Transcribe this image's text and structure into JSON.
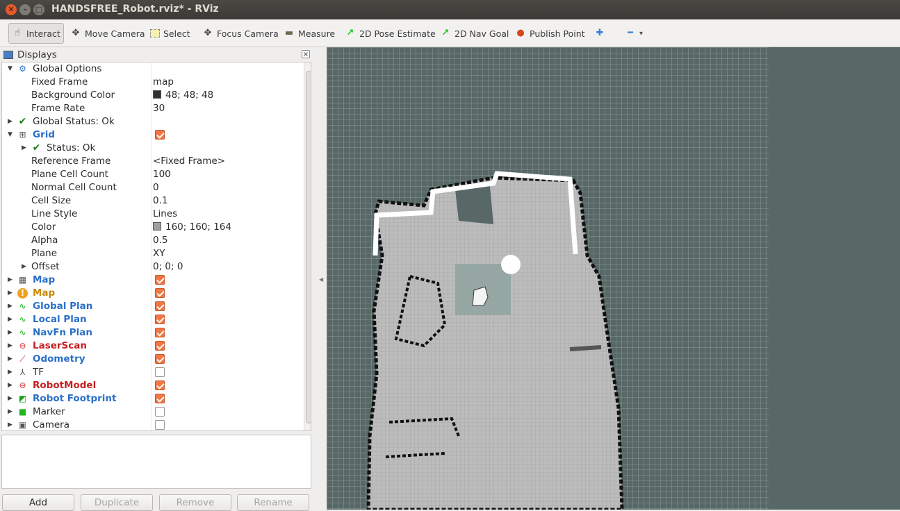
{
  "window": {
    "title": "HANDSFREE_Robot.rviz* - RViz",
    "close_glyph": "✕",
    "min_glyph": "–",
    "max_glyph": "□"
  },
  "toolbar": {
    "items": [
      {
        "label": "Interact",
        "icon": "hand-icon",
        "glyph": "☝"
      },
      {
        "label": "Move Camera",
        "icon": "move-camera-icon",
        "glyph": "✥"
      },
      {
        "label": "Select",
        "icon": "select-icon",
        "glyph": "⬚"
      },
      {
        "label": "Focus Camera",
        "icon": "focus-camera-icon",
        "glyph": "✥"
      },
      {
        "label": "Measure",
        "icon": "ruler-icon",
        "glyph": "▬"
      },
      {
        "label": "2D Pose Estimate",
        "icon": "green-arrow-icon",
        "glyph": "↗"
      },
      {
        "label": "2D Nav Goal",
        "icon": "green-arrow-icon",
        "glyph": "↗"
      },
      {
        "label": "Publish Point",
        "icon": "map-pin-icon",
        "glyph": "●"
      }
    ],
    "add_glyph": "✚",
    "remove_glyph": "━",
    "dropdown_glyph": "▾"
  },
  "displays": {
    "title": "Displays",
    "close_glyph": "×",
    "rows": [
      {
        "name": "Global Options",
        "val": "",
        "style": "",
        "arrow": "▼",
        "icon": "gear-icon",
        "glyph": "⚙",
        "indent": 0
      },
      {
        "name": "Fixed Frame",
        "val": "map",
        "indent": 2
      },
      {
        "name": "Background Color",
        "val": "48; 48; 48",
        "swatch": "#303030",
        "indent": 2
      },
      {
        "name": "Frame Rate",
        "val": "30",
        "indent": 2
      },
      {
        "name": "Global Status: Ok",
        "style": "",
        "arrow": "▶",
        "icon": "check-icon",
        "glyph": "✔",
        "indent": 0
      },
      {
        "name": "Grid",
        "style": "blue",
        "arrow": "▼",
        "icon": "grid-icon",
        "glyph": "⊞",
        "check": true,
        "indent": 0
      },
      {
        "name": "Status: Ok",
        "style": "",
        "arrow": "▶",
        "icon": "check-icon",
        "glyph": "✔",
        "indent": 1
      },
      {
        "name": "Reference Frame",
        "val": "<Fixed Frame>",
        "indent": 2
      },
      {
        "name": "Plane Cell Count",
        "val": "100",
        "indent": 2
      },
      {
        "name": "Normal Cell Count",
        "val": "0",
        "indent": 2
      },
      {
        "name": "Cell Size",
        "val": "0.1",
        "indent": 2
      },
      {
        "name": "Line Style",
        "val": "Lines",
        "indent": 2
      },
      {
        "name": "Color",
        "val": "160; 160; 164",
        "swatch": "#a0a0a4",
        "indent": 2
      },
      {
        "name": "Alpha",
        "val": "0.5",
        "indent": 2
      },
      {
        "name": "Plane",
        "val": "XY",
        "indent": 2
      },
      {
        "name": "Offset",
        "val": "0; 0; 0",
        "arrow": "▶",
        "indent": 2
      },
      {
        "name": "Map",
        "style": "blue",
        "arrow": "▶",
        "icon": "map-icon",
        "glyph": "▦",
        "check": true,
        "indent": 0
      },
      {
        "name": "Map",
        "style": "orange",
        "arrow": "▶",
        "icon": "warning-icon",
        "glyph": "!",
        "check": true,
        "indent": 0
      },
      {
        "name": "Global Plan",
        "style": "blue",
        "arrow": "▶",
        "icon": "path-icon",
        "glyph": "∿",
        "check": true,
        "indent": 0
      },
      {
        "name": "Local Plan",
        "style": "blue",
        "arrow": "▶",
        "icon": "path-icon",
        "glyph": "∿",
        "check": true,
        "indent": 0
      },
      {
        "name": "NavFn Plan",
        "style": "blue",
        "arrow": "▶",
        "icon": "path-icon",
        "glyph": "∿",
        "check": true,
        "indent": 0
      },
      {
        "name": "LaserScan",
        "style": "red",
        "arrow": "▶",
        "icon": "error-icon",
        "glyph": "⊖",
        "check": true,
        "indent": 0
      },
      {
        "name": "Odometry",
        "style": "blue",
        "arrow": "▶",
        "icon": "odometry-icon",
        "glyph": "⟋",
        "check": true,
        "indent": 0
      },
      {
        "name": "TF",
        "style": "",
        "arrow": "▶",
        "icon": "tf-icon",
        "glyph": "⅄",
        "check": false,
        "indent": 0
      },
      {
        "name": "RobotModel",
        "style": "red",
        "arrow": "▶",
        "icon": "error-icon",
        "glyph": "⊖",
        "check": true,
        "indent": 0
      },
      {
        "name": "Robot Footprint",
        "style": "blue",
        "arrow": "▶",
        "icon": "polygon-icon",
        "glyph": "◩",
        "check": true,
        "indent": 0
      },
      {
        "name": "Marker",
        "style": "",
        "arrow": "▶",
        "icon": "marker-cube-icon",
        "glyph": "■",
        "check": false,
        "indent": 0
      },
      {
        "name": "Camera",
        "style": "",
        "arrow": "▶",
        "icon": "camera-icon",
        "glyph": "▣",
        "check": false,
        "indent": 0
      }
    ],
    "buttons": {
      "add": "Add",
      "duplicate": "Duplicate",
      "remove": "Remove",
      "rename": "Rename"
    }
  },
  "colors": {
    "accent_blue": "#2a6fc9",
    "error_red": "#c41f1f",
    "warn_orange": "#c88a0b",
    "checkbox_on": "#f07746",
    "viewport_bg": "#576866"
  }
}
